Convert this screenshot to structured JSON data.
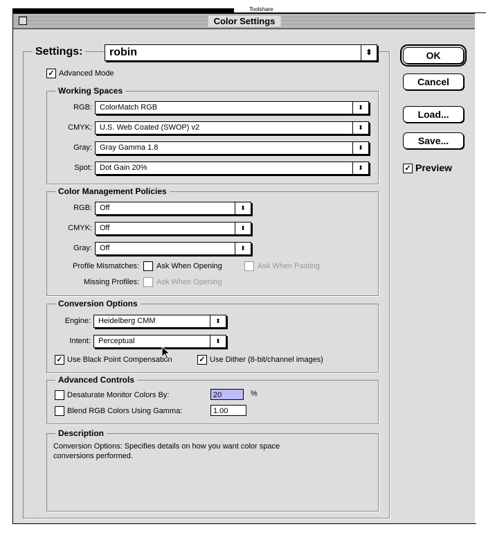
{
  "window": {
    "title": "Color Settings"
  },
  "settings": {
    "label": "Settings:",
    "value": "robin",
    "advanced_mode": "Advanced Mode",
    "advanced_checked": true
  },
  "working_spaces": {
    "title": "Working Spaces",
    "rows": [
      {
        "label": "RGB:",
        "value": "ColorMatch RGB"
      },
      {
        "label": "CMYK:",
        "value": "U.S. Web Coated (SWOP) v2"
      },
      {
        "label": "Gray:",
        "value": "Gray Gamma 1.8"
      },
      {
        "label": "Spot:",
        "value": "Dot Gain 20%"
      }
    ]
  },
  "policies": {
    "title": "Color Management Policies",
    "rows": [
      {
        "label": "RGB:",
        "value": "Off"
      },
      {
        "label": "CMYK:",
        "value": "Off"
      },
      {
        "label": "Gray:",
        "value": "Off"
      }
    ],
    "profile_mismatches": "Profile Mismatches:",
    "ask_opening": "Ask When Opening",
    "ask_pasting": "Ask When Pasting",
    "missing_profiles": "Missing Profiles:",
    "missing_ask_opening": "Ask When Opening"
  },
  "conversion": {
    "title": "Conversion Options",
    "engine_label": "Engine:",
    "engine_value": "Heidelberg CMM",
    "intent_label": "Intent:",
    "intent_value": "Perceptual",
    "black_point": "Use Black Point Compensation",
    "dither": "Use Dither (8-bit/channel images)"
  },
  "advanced": {
    "title": "Advanced Controls",
    "desaturate_label": "Desaturate Monitor Colors By:",
    "desaturate_value": "20",
    "desaturate_unit": "%",
    "blend_label": "Blend RGB Colors Using Gamma:",
    "blend_value": "1.00"
  },
  "description": {
    "title": "Description",
    "line1": "Conversion Options:  Specifies details on how you want color space",
    "line2": "conversions performed."
  },
  "buttons": {
    "ok": "OK",
    "cancel": "Cancel",
    "load": "Load...",
    "save": "Save...",
    "preview": "Preview"
  },
  "glyphs": {
    "check": "✓",
    "popup_arrow": "⬍"
  },
  "background_text": "Toolshare"
}
